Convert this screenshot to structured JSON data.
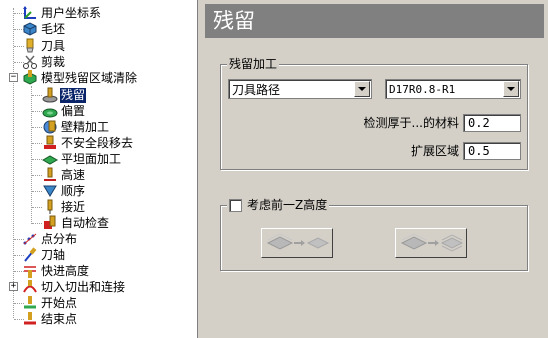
{
  "tree": {
    "items": [
      {
        "label": "用户坐标系",
        "icon": "ucs-axis-icon"
      },
      {
        "label": "毛坯",
        "icon": "block-icon"
      },
      {
        "label": "刀具",
        "icon": "tool-icon"
      },
      {
        "label": "剪裁",
        "icon": "trim-icon"
      },
      {
        "label": "模型残留区域清除",
        "icon": "rest-clearance-icon"
      },
      {
        "label": "残留",
        "icon": "rest-icon"
      },
      {
        "label": "偏置",
        "icon": "offset-icon"
      },
      {
        "label": "壁精加工",
        "icon": "wall-finish-icon"
      },
      {
        "label": "不安全段移去",
        "icon": "unsafe-segment-icon"
      },
      {
        "label": "平坦面加工",
        "icon": "flat-machining-icon"
      },
      {
        "label": "高速",
        "icon": "high-speed-icon"
      },
      {
        "label": "顺序",
        "icon": "order-icon"
      },
      {
        "label": "接近",
        "icon": "approach-icon"
      },
      {
        "label": "自动检查",
        "icon": "auto-verify-icon"
      },
      {
        "label": "点分布",
        "icon": "point-distribution-icon"
      },
      {
        "label": "刀轴",
        "icon": "tool-axis-icon"
      },
      {
        "label": "快进高度",
        "icon": "rapid-height-icon"
      },
      {
        "label": "切入切出和连接",
        "icon": "leads-links-icon"
      },
      {
        "label": "开始点",
        "icon": "start-point-icon"
      },
      {
        "label": "结束点",
        "icon": "end-point-icon"
      }
    ],
    "expander_minus": "−",
    "expander_plus": "+"
  },
  "panel": {
    "heading": "残留",
    "rest_group": {
      "title": "残留加工",
      "type_select": "刀具路径",
      "toolpath_select": "D17R0.8-R1",
      "thicker_label": "检测厚于...的材料",
      "thicker_value": "0.2",
      "expand_label": "扩展区域",
      "expand_value": "0.5"
    },
    "z_group": {
      "checkbox_label": "考虑前一Z高度",
      "checked": false
    }
  },
  "colors": {
    "heading_bg": "#808080",
    "selection_bg": "#0a246a",
    "panel_bg": "#d4d0c8"
  }
}
